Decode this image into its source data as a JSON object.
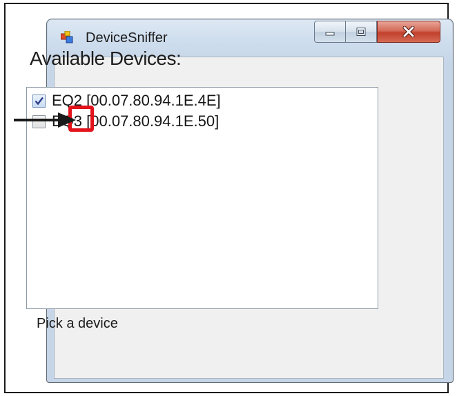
{
  "window": {
    "title": "DeviceSniffer",
    "icon": "app-icon",
    "controls": [
      "minimize-icon",
      "maximize-icon",
      "close-icon"
    ]
  },
  "main": {
    "heading": "Available Devices:",
    "devices": [
      {
        "label": "EQ2  [00.07.80.94.1E.4E]",
        "checked": true
      },
      {
        "label": "EQ3  [00.07.80.94.1E.50]",
        "checked": false
      }
    ],
    "status": "Pick a device"
  },
  "annotation": {
    "highlight_color": "#e3131c",
    "arrow_color": "#1a1a1a"
  }
}
